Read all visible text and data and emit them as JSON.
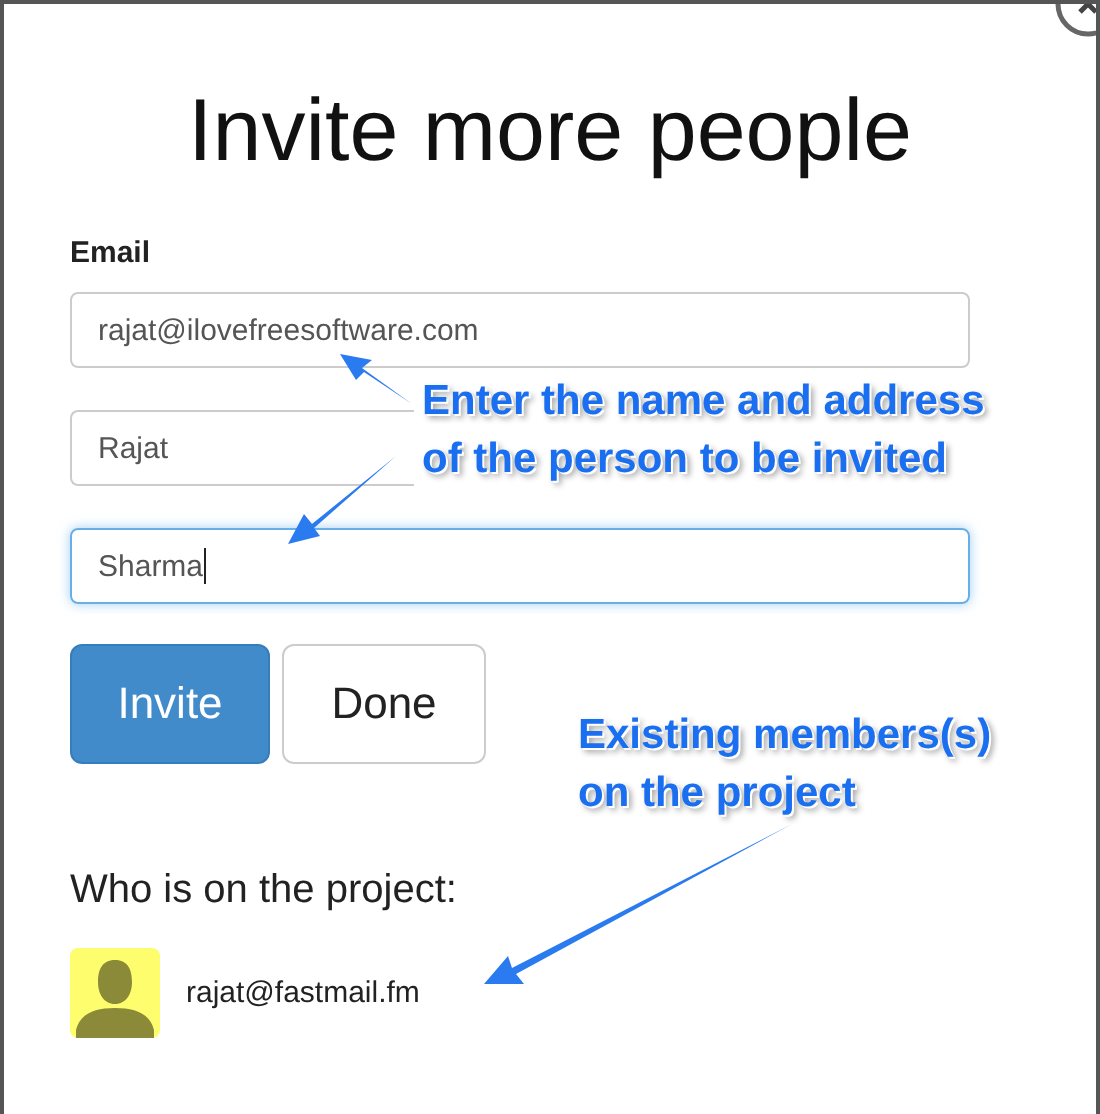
{
  "title": "Invite more people",
  "email_label": "Email",
  "fields": [
    {
      "value": "rajat@ilovefreesoftware.com",
      "focused": false
    },
    {
      "value": "Rajat",
      "focused": false
    },
    {
      "value": "Sharma",
      "focused": true
    }
  ],
  "buttons": [
    {
      "label": "Invite",
      "kind": "primary"
    },
    {
      "label": "Done",
      "kind": "default"
    }
  ],
  "members_heading": "Who is on the project:",
  "members": [
    {
      "email": "rajat@fastmail.fm"
    }
  ],
  "annotations": [
    {
      "lines": [
        "Enter the name and address",
        "of the person to be invited"
      ]
    },
    {
      "lines": [
        "Existing members(s)",
        "on the project"
      ]
    }
  ]
}
